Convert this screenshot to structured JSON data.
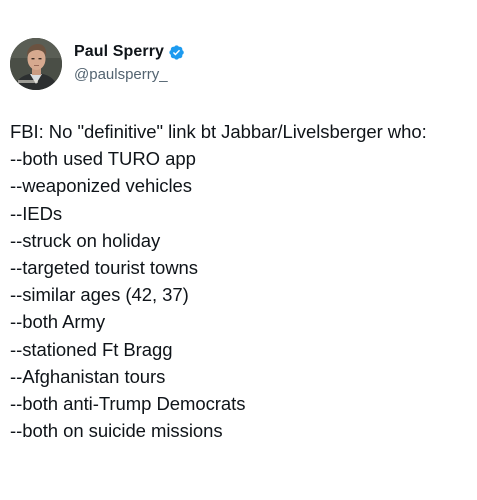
{
  "tweet": {
    "author": {
      "display_name": "Paul Sperry",
      "handle": "@paulsperry_",
      "verified_icon": "verified-badge-icon",
      "verified_color": "#1d9bf0"
    },
    "lines": [
      "FBI: No \"definitive\" link bt Jabbar/Livelsberger who:",
      "--both used TURO app",
      "--weaponized vehicles",
      "--IEDs",
      "--struck on holiday",
      "--targeted tourist towns",
      "--similar ages (42, 37)",
      "--both Army",
      "--stationed Ft Bragg",
      "--Afghanistan tours",
      "--both anti-Trump Democrats",
      "--both on suicide missions"
    ]
  }
}
